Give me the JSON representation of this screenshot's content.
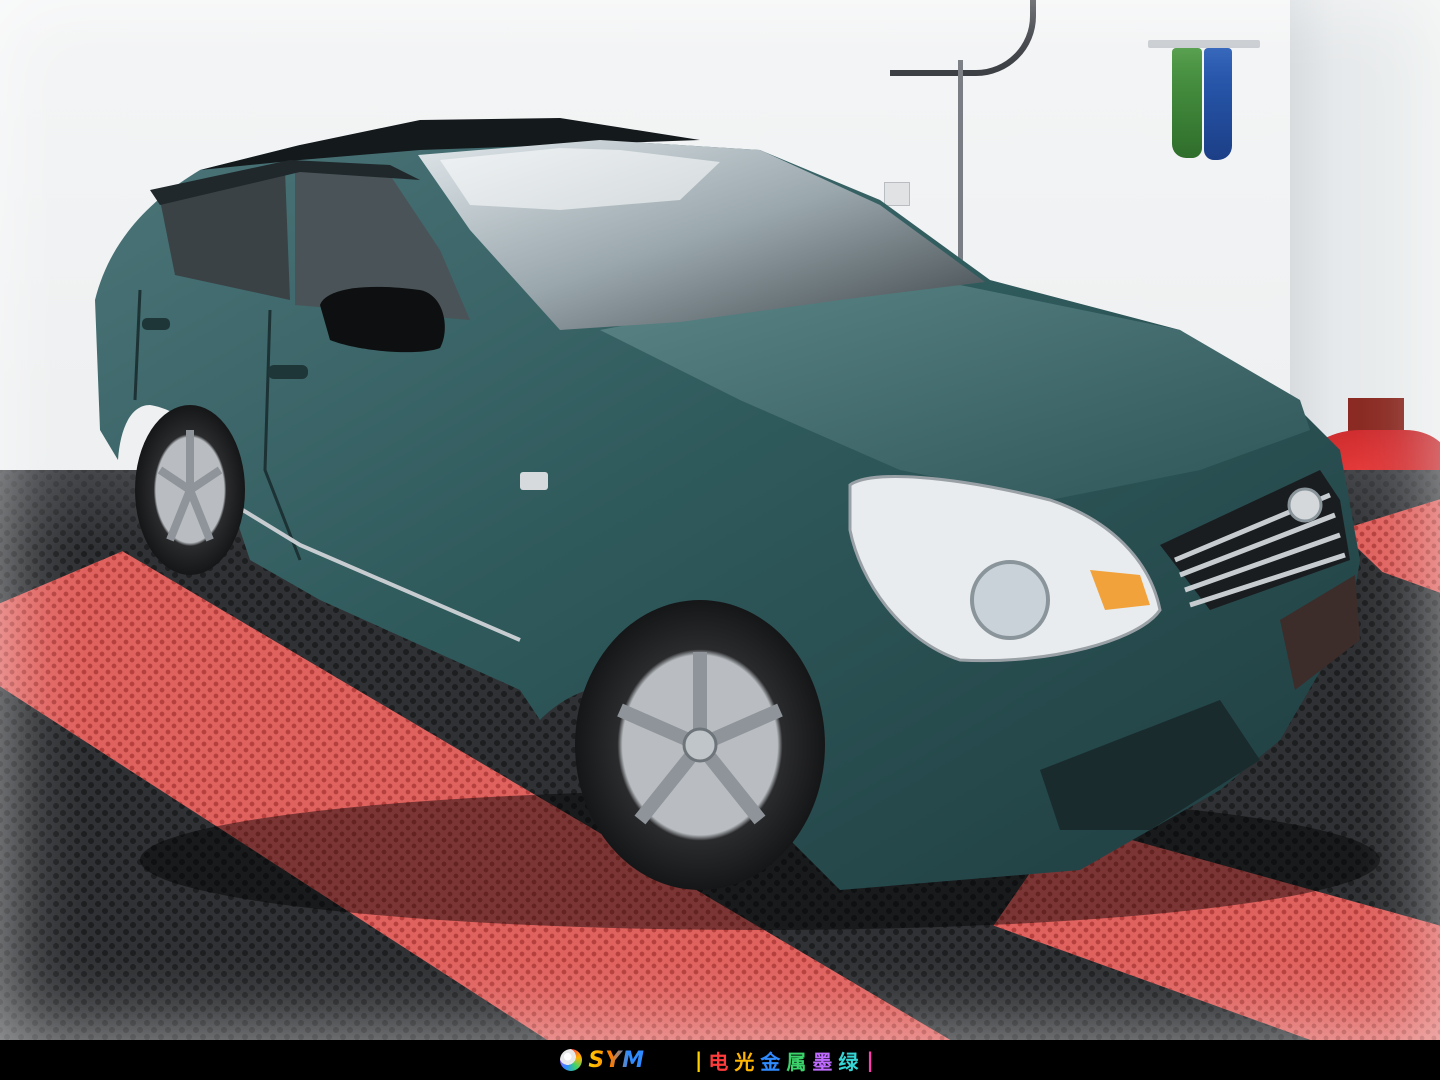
{
  "footer": {
    "brand": "SYM",
    "caption_chars": [
      "电",
      "光",
      "金",
      "属",
      "墨",
      "绿"
    ],
    "caption_colors": [
      "#ff3b3b",
      "#ffb400",
      "#2f8bff",
      "#3bd46b",
      "#c06bff",
      "#36d6d6"
    ],
    "divider_left": "|",
    "divider_right": "|"
  },
  "colors": {
    "car_wrap": "#2f5a5c",
    "floor_dark": "#2f3134",
    "floor_stripe": "#e0625f"
  }
}
